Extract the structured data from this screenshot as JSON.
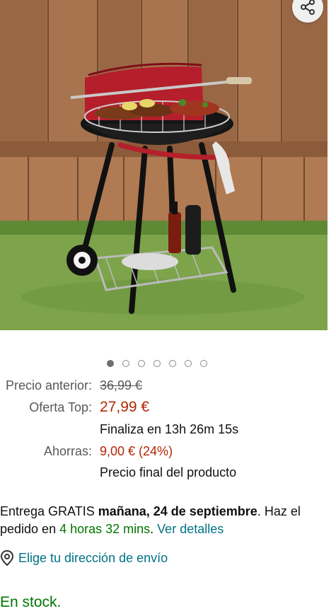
{
  "gallery": {
    "image_description_icon": "bbq-grill-product-photo",
    "share_icon": "share-icon",
    "dots_total": 7,
    "active_index": 0
  },
  "pricing": {
    "previous_label": "Precio anterior:",
    "previous_value": "36,99 €",
    "offer_label": "Oferta Top:",
    "offer_value": "27,99 €",
    "offer_timer": "Finaliza en 13h 26m 15s",
    "savings_label": "Ahorras:",
    "savings_value": "9,00 € (24%)",
    "final_note": "Precio final del producto"
  },
  "delivery": {
    "prefix": "Entrega GRATIS ",
    "date": "mañana, 24 de septiembre",
    "middle": ". Haz el pedido en ",
    "countdown": "4 horas 32 mins",
    "sep": ". ",
    "details_link": "Ver detalles"
  },
  "address": {
    "label": "Elige tu dirección de envío"
  },
  "stock": {
    "status": "En stock."
  },
  "colors": {
    "price_red": "#b12704",
    "link_teal": "#007185",
    "stock_green": "#007600"
  }
}
